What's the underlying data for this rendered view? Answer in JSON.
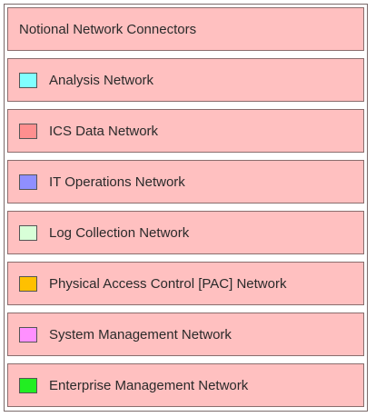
{
  "legend": {
    "title": "Notional Network Connectors",
    "items": [
      {
        "label": "Analysis Network",
        "color": "#80ffff"
      },
      {
        "label": "ICS Data Network",
        "color": "#ff8f8f"
      },
      {
        "label": "IT Operations Network",
        "color": "#8f8fff"
      },
      {
        "label": "Log Collection Network",
        "color": "#d8ffd8"
      },
      {
        "label": "Physical Access Control [PAC] Network",
        "color": "#ffc000"
      },
      {
        "label": "System Management Network",
        "color": "#ff90ff"
      },
      {
        "label": "Enterprise Management Network",
        "color": "#22ee22"
      }
    ]
  }
}
